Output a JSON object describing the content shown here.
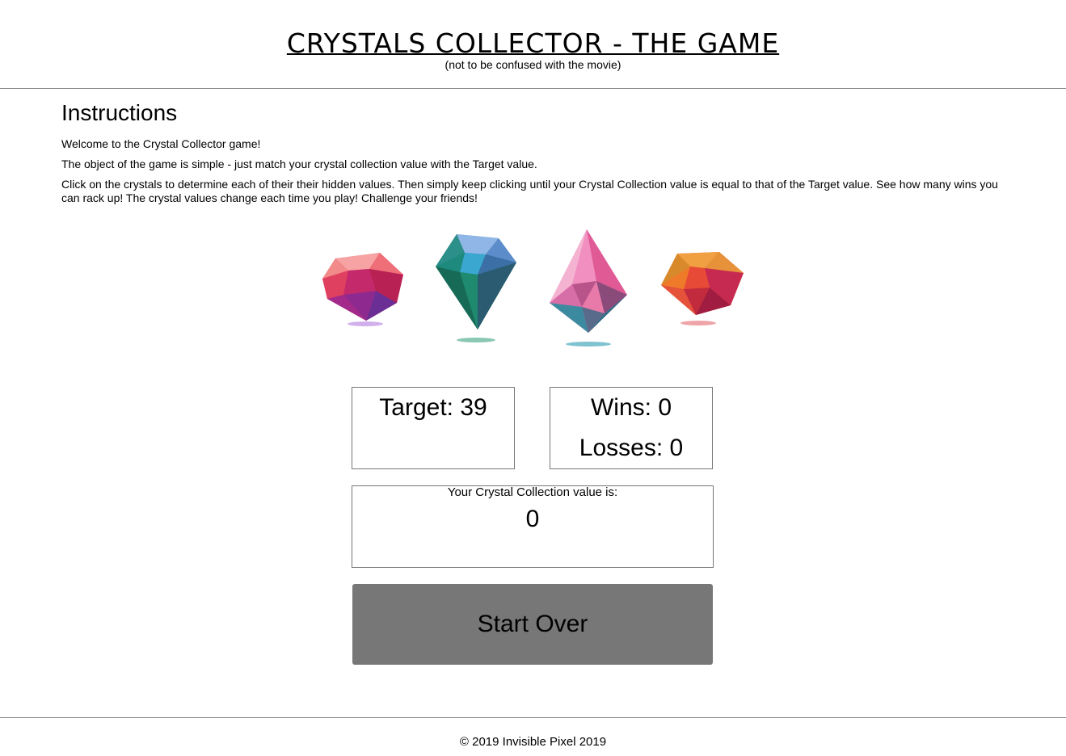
{
  "header": {
    "title": "CRYSTALS COLLECTOR - THE GAME",
    "subtitle": "(not to be confused with the movie)"
  },
  "instructions": {
    "heading": "Instructions",
    "paragraphs": [
      "Welcome to the Crystal Collector game!",
      "The object of the game is simple - just match your crystal collection value with the Target value.",
      "Click on the crystals to determine each of their their hidden values. Then simply keep clicking until your Crystal Collection value is equal to that of the Target value. See how many wins you can rack up! The crystal values change each time you play! Challenge your friends!"
    ]
  },
  "crystals": [
    {
      "name": "red-crystal",
      "color": "#d8325a"
    },
    {
      "name": "green-crystal",
      "color": "#1e7a6a"
    },
    {
      "name": "pink-crystal",
      "color": "#e77aa8"
    },
    {
      "name": "orange-crystal",
      "color": "#e8602f"
    }
  ],
  "game": {
    "target_label": "Target: 39",
    "wins_label": "Wins: 0",
    "losses_label": "Losses: 0",
    "collection_label": "Your Crystal Collection value is:",
    "collection_value": "0",
    "start_over_label": "Start Over"
  },
  "footer": {
    "copyright": "© 2019 Invisible Pixel 2019"
  },
  "colors": {
    "button_bg": "#777777",
    "border": "#777777"
  }
}
